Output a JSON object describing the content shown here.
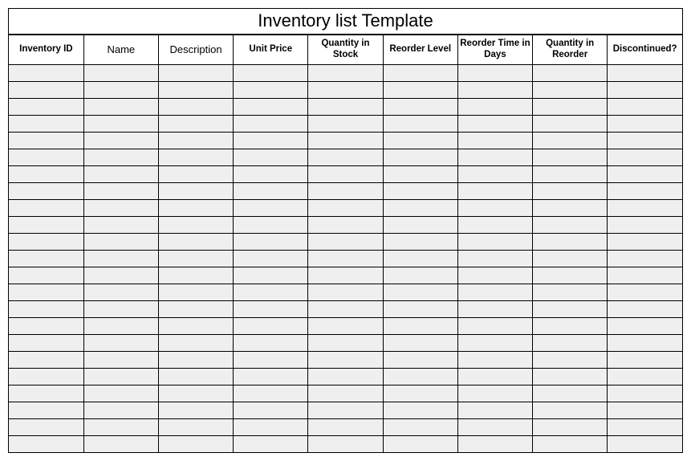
{
  "title": "Inventory list Template",
  "columns": [
    "Inventory ID",
    "Name",
    "Description",
    "Unit Price",
    "Quantity in Stock",
    "Reorder Level",
    "Reorder Time in Days",
    "Quantity in Reorder",
    "Discontinued?"
  ],
  "rows": [
    [
      "",
      "",
      "",
      "",
      "",
      "",
      "",
      "",
      ""
    ],
    [
      "",
      "",
      "",
      "",
      "",
      "",
      "",
      "",
      ""
    ],
    [
      "",
      "",
      "",
      "",
      "",
      "",
      "",
      "",
      ""
    ],
    [
      "",
      "",
      "",
      "",
      "",
      "",
      "",
      "",
      ""
    ],
    [
      "",
      "",
      "",
      "",
      "",
      "",
      "",
      "",
      ""
    ],
    [
      "",
      "",
      "",
      "",
      "",
      "",
      "",
      "",
      ""
    ],
    [
      "",
      "",
      "",
      "",
      "",
      "",
      "",
      "",
      ""
    ],
    [
      "",
      "",
      "",
      "",
      "",
      "",
      "",
      "",
      ""
    ],
    [
      "",
      "",
      "",
      "",
      "",
      "",
      "",
      "",
      ""
    ],
    [
      "",
      "",
      "",
      "",
      "",
      "",
      "",
      "",
      ""
    ],
    [
      "",
      "",
      "",
      "",
      "",
      "",
      "",
      "",
      ""
    ],
    [
      "",
      "",
      "",
      "",
      "",
      "",
      "",
      "",
      ""
    ],
    [
      "",
      "",
      "",
      "",
      "",
      "",
      "",
      "",
      ""
    ],
    [
      "",
      "",
      "",
      "",
      "",
      "",
      "",
      "",
      ""
    ],
    [
      "",
      "",
      "",
      "",
      "",
      "",
      "",
      "",
      ""
    ],
    [
      "",
      "",
      "",
      "",
      "",
      "",
      "",
      "",
      ""
    ],
    [
      "",
      "",
      "",
      "",
      "",
      "",
      "",
      "",
      ""
    ],
    [
      "",
      "",
      "",
      "",
      "",
      "",
      "",
      "",
      ""
    ],
    [
      "",
      "",
      "",
      "",
      "",
      "",
      "",
      "",
      ""
    ],
    [
      "",
      "",
      "",
      "",
      "",
      "",
      "",
      "",
      ""
    ],
    [
      "",
      "",
      "",
      "",
      "",
      "",
      "",
      "",
      ""
    ],
    [
      "",
      "",
      "",
      "",
      "",
      "",
      "",
      "",
      ""
    ],
    [
      "",
      "",
      "",
      "",
      "",
      "",
      "",
      "",
      ""
    ]
  ]
}
